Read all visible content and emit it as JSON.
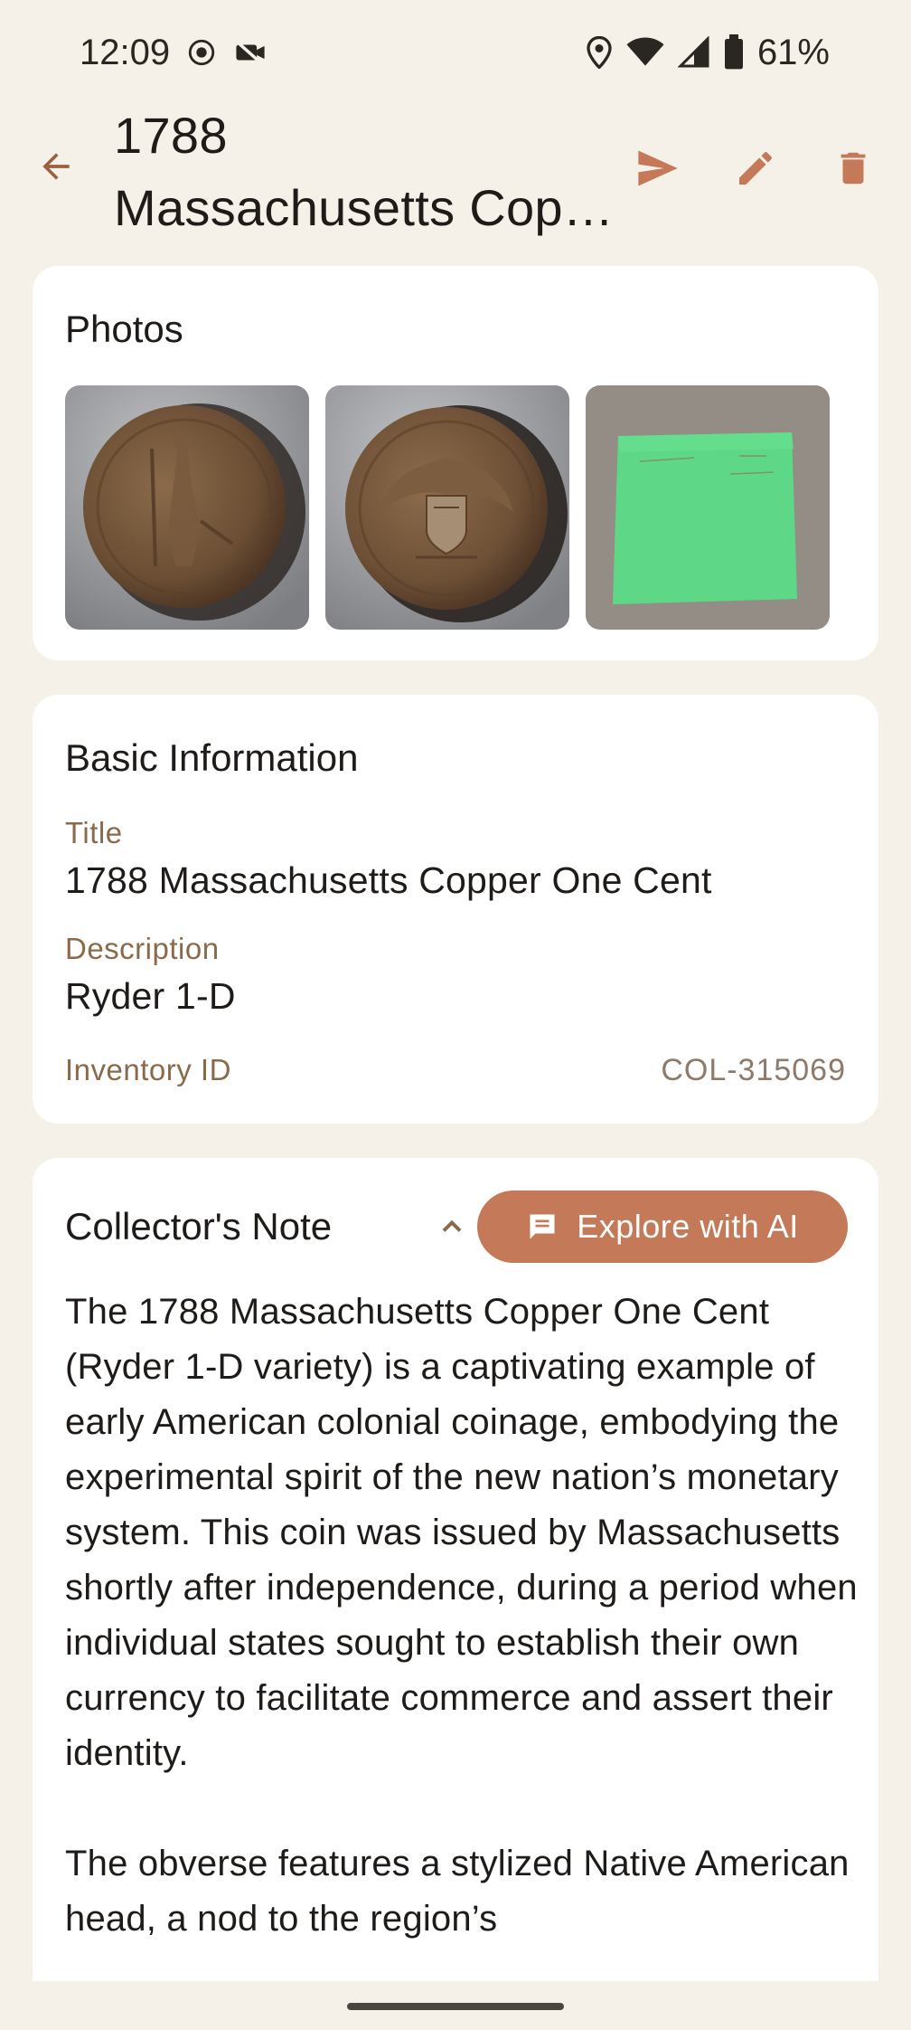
{
  "status_bar": {
    "time": "12:09",
    "battery": "61%",
    "icons": [
      "screen-record-icon",
      "camera-off-icon",
      "location-icon",
      "wifi-icon",
      "signal-icon",
      "battery-icon"
    ]
  },
  "app_bar": {
    "title_line1": "1788",
    "title_line2": "Massachusetts Copper One Cent",
    "actions": [
      "send-icon",
      "edit-icon",
      "delete-icon"
    ]
  },
  "photos": {
    "heading": "Photos"
  },
  "basic_info": {
    "heading": "Basic Information",
    "title_label": "Title",
    "title_value": "1788 Massachusetts Copper One Cent",
    "description_label": "Description",
    "description_value": "Ryder 1-D",
    "inventory_label": "Inventory ID",
    "inventory_value": "COL-315069"
  },
  "collectors_note": {
    "heading": "Collector's Note",
    "ai_button_label": "Explore with AI",
    "paragraph1": "The 1788 Massachusetts Copper One Cent (Ryder 1-D variety) is a captivating example of early American colonial coinage, embodying the experimental spirit of the new nation’s monetary system. This coin was issued by Massachusetts shortly after independence, during a period when individual states sought to establish their own currency to facilitate commerce and assert their identity.",
    "paragraph2": "The obverse features a stylized Native American head, a nod to the region’s"
  },
  "colors": {
    "background": "#f5f1e9",
    "accent": "#c47a58",
    "label": "#8a6a4a"
  }
}
